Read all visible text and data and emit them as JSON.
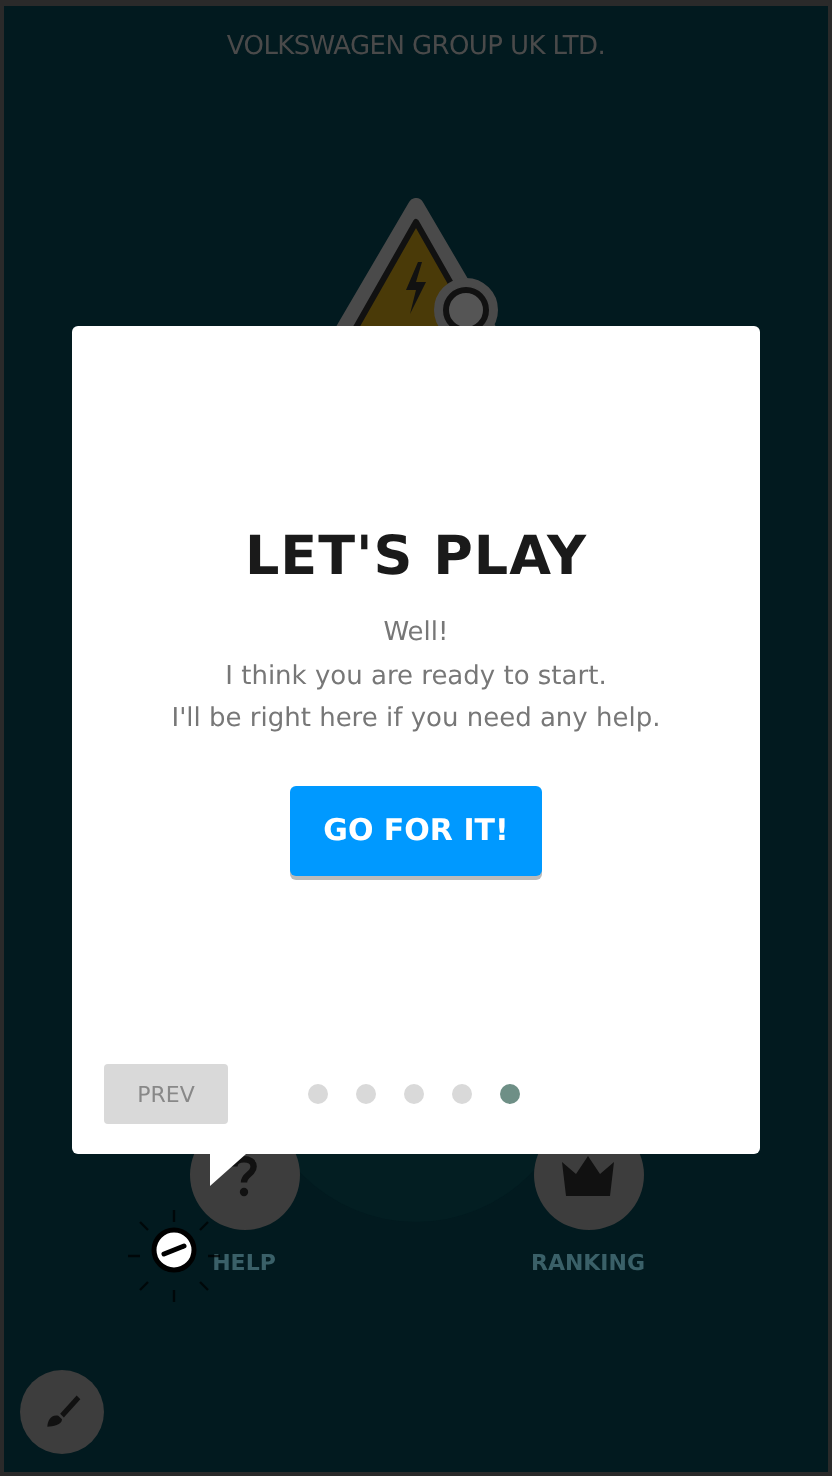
{
  "header": {
    "title": "VOLKSWAGEN GROUP UK LTD."
  },
  "menu": [
    {
      "kind": "help",
      "label": "HELP"
    },
    {
      "kind": "ranking",
      "label": "RANKING"
    }
  ],
  "dialog": {
    "title": "LET'S PLAY",
    "lines": [
      "Well!",
      "I think you are ready to start.",
      "I'll be right here if you need any help."
    ],
    "action": "GO FOR IT!",
    "prev": "PREV",
    "steps": [
      {
        "selected": false
      },
      {
        "selected": false
      },
      {
        "selected": false
      },
      {
        "selected": false
      },
      {
        "selected": true
      }
    ]
  }
}
